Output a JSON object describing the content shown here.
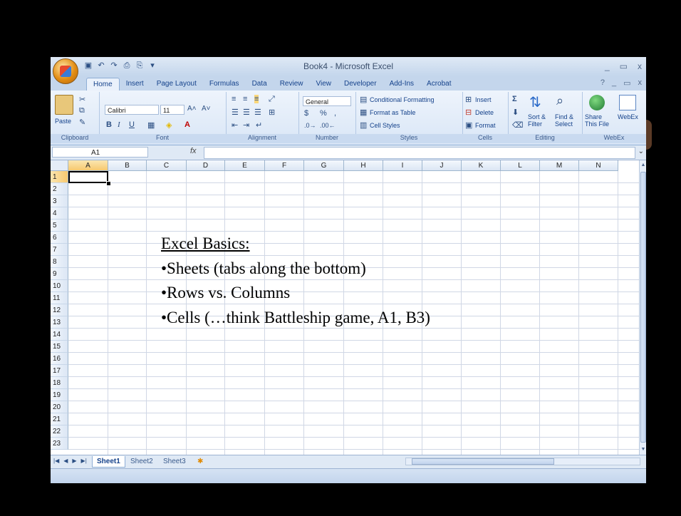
{
  "window": {
    "title": "Book4 - Microsoft Excel",
    "controls": [
      "_",
      "▭",
      "x"
    ],
    "help_controls": [
      "?",
      "_",
      "▭",
      "x"
    ]
  },
  "quick_access": [
    "save-icon",
    "undo-icon",
    "redo-icon",
    "print-preview-icon",
    "print-icon"
  ],
  "tabs": [
    "Home",
    "Insert",
    "Page Layout",
    "Formulas",
    "Data",
    "Review",
    "View",
    "Developer",
    "Add-Ins",
    "Acrobat"
  ],
  "active_tab": "Home",
  "ribbon": {
    "clipboard": {
      "label": "Clipboard",
      "paste": "Paste"
    },
    "font": {
      "label": "Font",
      "family": "Calibri",
      "size": "11",
      "bold": "B",
      "italic": "I",
      "underline": "U"
    },
    "alignment": {
      "label": "Alignment"
    },
    "number": {
      "label": "Number",
      "format": "General",
      "currency": "$",
      "percent": "%",
      "comma": ","
    },
    "styles": {
      "label": "Styles",
      "conditional": "Conditional Formatting",
      "format_table": "Format as Table",
      "cell_styles": "Cell Styles"
    },
    "cells": {
      "label": "Cells",
      "insert": "Insert",
      "delete": "Delete",
      "format": "Format"
    },
    "editing": {
      "label": "Editing",
      "sort": "Sort &",
      "sort2": "Filter",
      "find": "Find &",
      "find2": "Select",
      "sigma": "Σ"
    },
    "webex": {
      "label": "WebEx",
      "share": "Share",
      "share2": "This File",
      "webex": "WebEx"
    }
  },
  "formula_bar": {
    "name_box": "A1",
    "fx": "fx",
    "content": ""
  },
  "columns": [
    "A",
    "B",
    "C",
    "D",
    "E",
    "F",
    "G",
    "H",
    "I",
    "J",
    "K",
    "L",
    "M",
    "N"
  ],
  "rows": [
    "1",
    "2",
    "3",
    "4",
    "5",
    "6",
    "7",
    "8",
    "9",
    "10",
    "11",
    "12",
    "13",
    "14",
    "15",
    "16",
    "17",
    "18",
    "19",
    "20",
    "21",
    "22",
    "23"
  ],
  "selected_cell": "A1",
  "sheets": [
    "Sheet1",
    "Sheet2",
    "Sheet3"
  ],
  "active_sheet": "Sheet1",
  "overlay": {
    "title": "Excel Basics:",
    "bullets": [
      "•Sheets (tabs along the bottom)",
      "•Rows vs. Columns",
      "•Cells (…think Battleship game, A1, B3)"
    ]
  }
}
